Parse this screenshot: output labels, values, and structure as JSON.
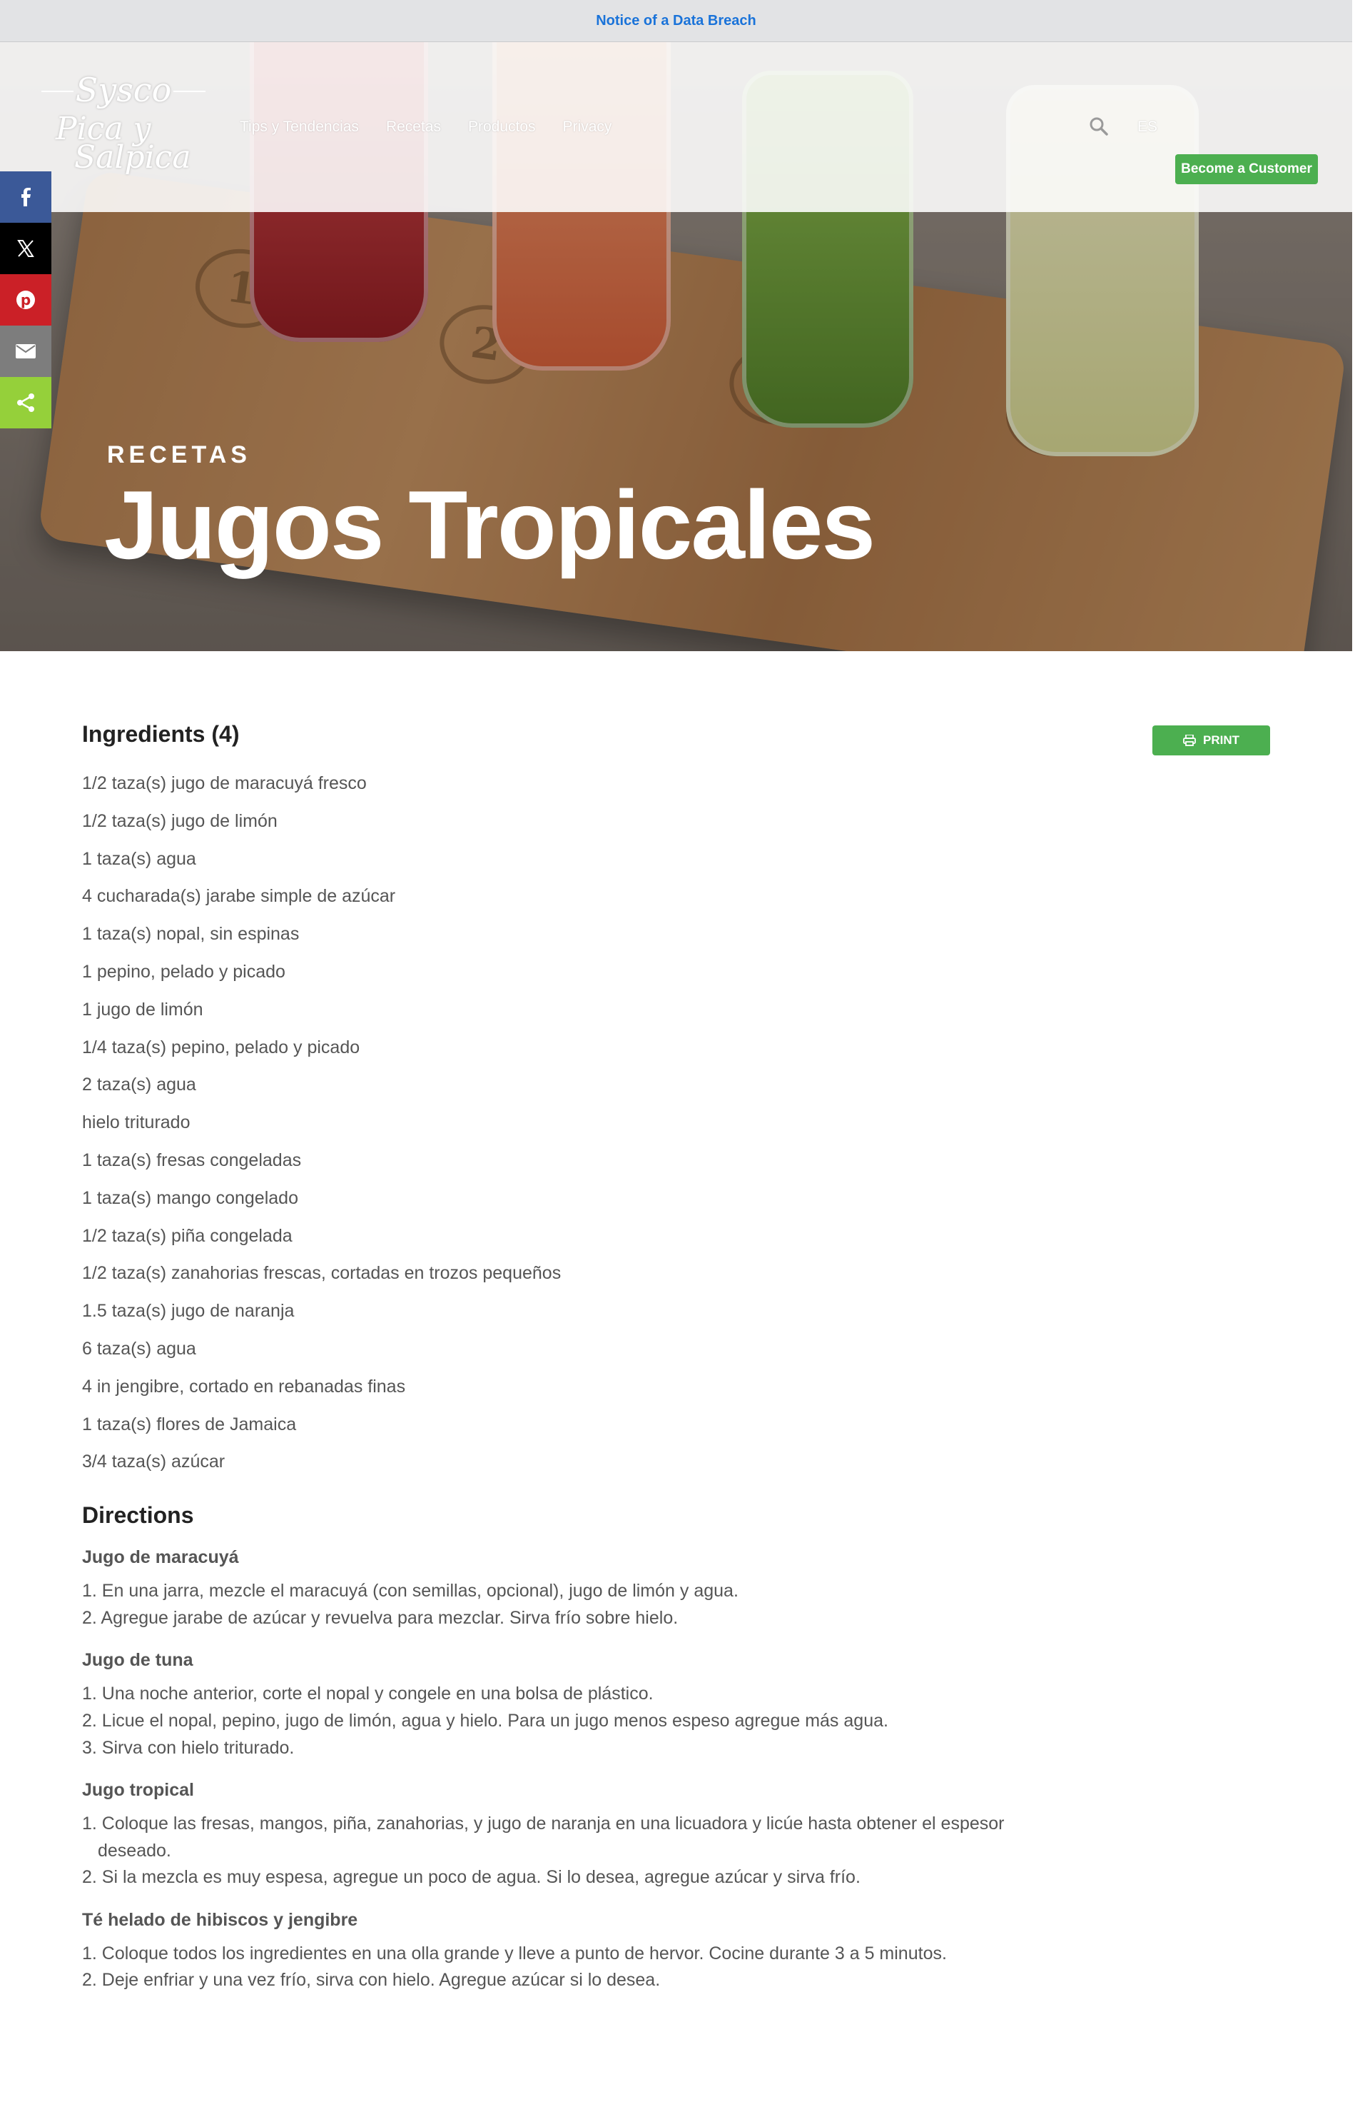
{
  "notice": {
    "text": "Notice of a Data Breach"
  },
  "logo": {
    "top": "Sysco",
    "line1": "Pica y",
    "line2": "Salpica"
  },
  "nav": {
    "items": [
      "Tips y Tendencias",
      "Recetas",
      "Productos",
      "Privacy"
    ],
    "language": "ES",
    "cta": "Become a Customer"
  },
  "share": [
    "facebook-icon",
    "x-icon",
    "pinterest-icon",
    "email-icon",
    "share-icon"
  ],
  "hero": {
    "kicker": "RECETAS",
    "title": "Jugos Tropicales"
  },
  "ingredients": {
    "heading": "Ingredients (4)",
    "print_label": "PRINT",
    "items": [
      "1/2 taza(s) jugo de maracuyá fresco",
      "1/2 taza(s) jugo de limón",
      "1 taza(s) agua",
      "4 cucharada(s) jarabe simple de azúcar",
      "1 taza(s) nopal, sin espinas",
      "1 pepino, pelado y picado",
      "1 jugo de limón",
      "1/4 taza(s) pepino, pelado y picado",
      "2 taza(s) agua",
      "hielo triturado",
      "1 taza(s) fresas congeladas",
      "1 taza(s) mango congelado",
      "1/2 taza(s) piña congelada",
      "1/2 taza(s) zanahorias frescas, cortadas en trozos pequeños",
      "1.5 taza(s) jugo de naranja",
      "6 taza(s) agua",
      "4 in jengibre, cortado en rebanadas finas",
      "1 taza(s) flores de Jamaica",
      "3/4 taza(s) azúcar"
    ]
  },
  "directions": {
    "heading": "Directions",
    "sections": [
      {
        "title": "Jugo de maracuyá",
        "steps": [
          "1. En una jarra, mezcle el maracuyá (con semillas, opcional), jugo de limón y agua.",
          "2. Agregue jarabe de azúcar y revuelva para mezclar. Sirva frío sobre hielo."
        ]
      },
      {
        "title": "Jugo de tuna",
        "steps": [
          "1. Una noche anterior, corte el nopal y congele en una bolsa de plástico.",
          "2. Licue el nopal, pepino, jugo de limón, agua y hielo. Para un jugo menos espeso agregue más agua.",
          "3. Sirva con hielo triturado."
        ]
      },
      {
        "title": "Jugo tropical",
        "steps": [
          "1. Coloque las fresas, mangos, piña, zanahorias, y jugo de naranja en una licuadora y licúe hasta obtener el espesor deseado.",
          "2. Si la mezcla es muy espesa, agregue un poco de agua. Si lo desea, agregue azúcar y sirva frío."
        ]
      },
      {
        "title": "Té helado de hibiscos y jengibre",
        "steps": [
          "1. Coloque todos los ingredientes en una olla grande y lleve a punto de hervor. Cocine durante 3 a 5 minutos.",
          "2. Deje enfriar y una vez frío, sirva con hielo. Agregue azúcar si lo desea."
        ]
      }
    ]
  },
  "colors": {
    "accent_green": "#4caf50",
    "notice_link": "#1a73d9"
  }
}
